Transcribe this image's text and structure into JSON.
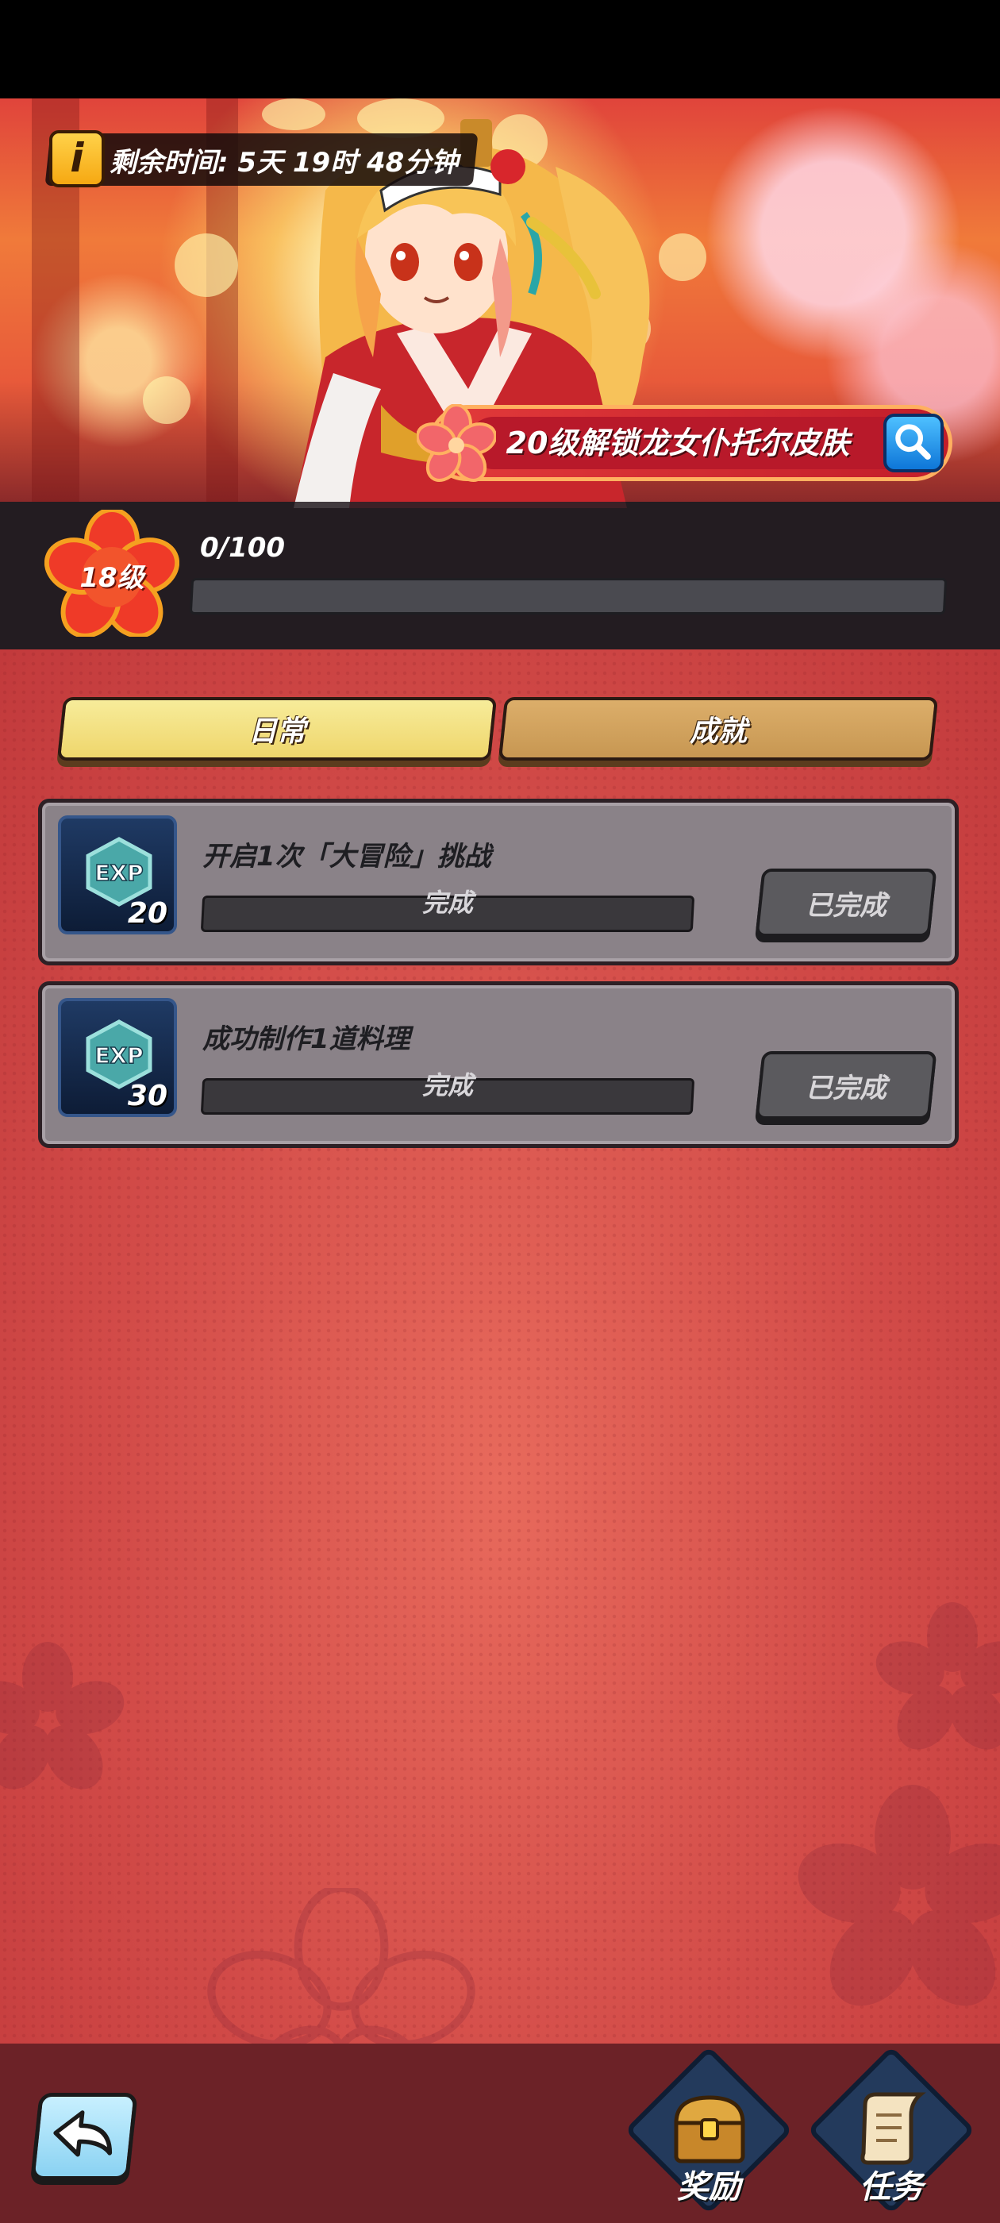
{
  "banner": {
    "timer_text": "剩余时间: 5天 19时 48分钟",
    "info_icon": "info-icon",
    "unlock_text": "20级解锁龙女仆托尔皮肤",
    "search_icon": "search-icon"
  },
  "level": {
    "label": "18级",
    "progress_text": "0/100",
    "progress_fraction": 0.0
  },
  "tabs": [
    {
      "label": "日常",
      "active": true
    },
    {
      "label": "成就",
      "active": false
    }
  ],
  "tasks": [
    {
      "exp": "20",
      "title": "开启1次「大冒险」挑战",
      "bar_text": "完成",
      "button": "已完成"
    },
    {
      "exp": "30",
      "title": "成功制作1道料理",
      "bar_text": "完成",
      "button": "已完成"
    }
  ],
  "exp_badge_text": "EXP",
  "bottom_nav": [
    {
      "label": "奖励",
      "icon": "treasure-chest-icon"
    },
    {
      "label": "任务",
      "icon": "scroll-quill-icon"
    }
  ],
  "colors": {
    "panel_red": "#d24b48",
    "tab_active": "#f3e58a",
    "tab_inactive": "#d2a460",
    "card_grey": "#8a8288"
  }
}
